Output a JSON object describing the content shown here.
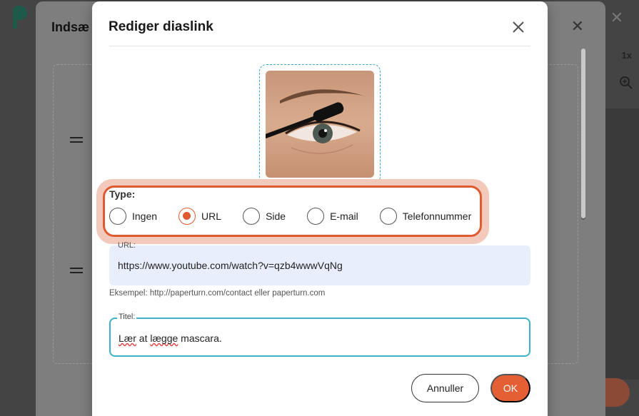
{
  "background": {
    "outer_title": "Indsæ",
    "speed": "1x",
    "ok_label": "OK"
  },
  "modal": {
    "title": "Rediger diaslink",
    "image_alt": "eye with mascara brush",
    "type": {
      "label": "Type:",
      "options": [
        {
          "label": "Ingen",
          "checked": false
        },
        {
          "label": "URL",
          "checked": true
        },
        {
          "label": "Side",
          "checked": false
        },
        {
          "label": "E-mail",
          "checked": false
        },
        {
          "label": "Telefonnummer",
          "checked": false
        }
      ]
    },
    "url": {
      "legend": "URL:",
      "value": "https://www.youtube.com/watch?v=qzb4wwwVqNg",
      "hint": "Eksempel: http://paperturn.com/contact eller paperturn.com"
    },
    "title_field": {
      "legend": "Titel:",
      "value_parts": [
        "Lær",
        " at ",
        "lægge",
        " mascara."
      ]
    },
    "buttons": {
      "cancel": "Annuller",
      "ok": "OK"
    }
  },
  "colors": {
    "accent": "#e55f35",
    "focus": "#3cb2c9",
    "url_bg": "#e8eefb"
  }
}
